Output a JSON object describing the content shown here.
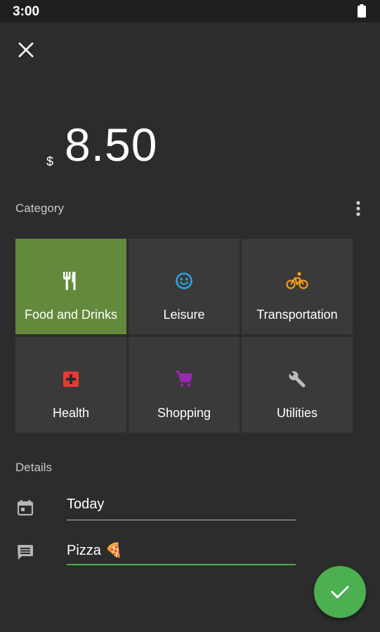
{
  "status_bar": {
    "time": "3:00",
    "battery_icon": "battery-full-icon"
  },
  "header": {
    "close_icon": "close-icon"
  },
  "amount": {
    "currency": "$",
    "value": "8.50"
  },
  "category_section": {
    "title": "Category",
    "more_icon": "more-vert-icon",
    "items": [
      {
        "label": "Food and Drinks",
        "icon": "restaurant-icon",
        "color": "#ffffff",
        "selected": true
      },
      {
        "label": "Leisure",
        "icon": "smiley-icon",
        "color": "#29a3e3",
        "selected": false
      },
      {
        "label": "Transportation",
        "icon": "bike-icon",
        "color": "#f59c1a",
        "selected": false
      },
      {
        "label": "Health",
        "icon": "medical-cross-icon",
        "color": "#e53935",
        "selected": false
      },
      {
        "label": "Shopping",
        "icon": "shopping-cart-icon",
        "color": "#9c27b0",
        "selected": false
      },
      {
        "label": "Utilities",
        "icon": "wrench-icon",
        "color": "#bdbdbd",
        "selected": false
      }
    ]
  },
  "details_section": {
    "title": "Details",
    "date": {
      "icon": "calendar-icon",
      "value": "Today"
    },
    "note": {
      "icon": "comment-icon",
      "value": "Pizza 🍕"
    }
  },
  "fab": {
    "icon": "check-icon"
  },
  "colors": {
    "background": "#2c2c2c",
    "tile": "#3a3a3a",
    "selected_tile": "#638a3c",
    "accent": "#4caf50"
  }
}
